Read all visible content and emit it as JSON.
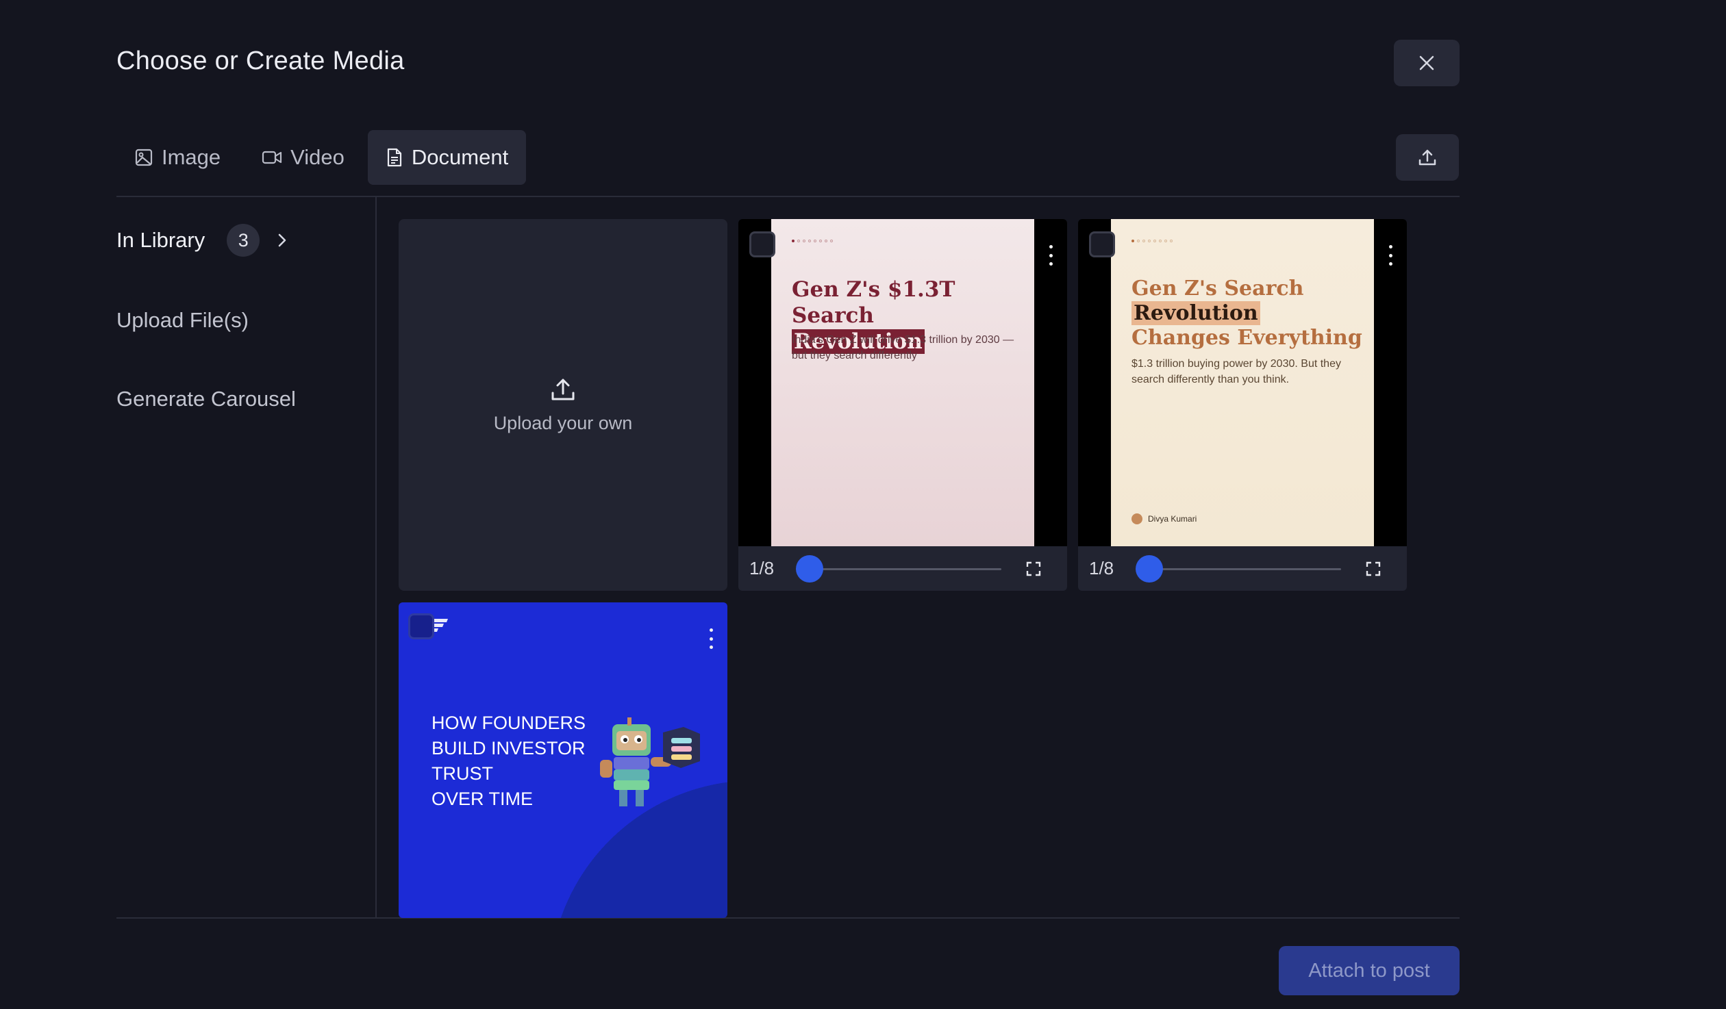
{
  "modal": {
    "title": "Choose or Create Media",
    "close_icon": "close-icon",
    "upload_icon": "upload-icon"
  },
  "tabs": [
    {
      "label": "Image",
      "icon": "image-icon",
      "active": false
    },
    {
      "label": "Video",
      "icon": "video-icon",
      "active": false
    },
    {
      "label": "Document",
      "icon": "document-icon",
      "active": true
    }
  ],
  "sidebar": {
    "in_library": {
      "label": "In Library",
      "count": "3",
      "icon": "chevron-right-icon"
    },
    "upload_files": {
      "label": "Upload File(s)"
    },
    "generate_carousel": {
      "label": "Generate Carousel"
    }
  },
  "grid": {
    "upload_card": {
      "label": "Upload your own",
      "icon": "upload-icon"
    },
    "documents": [
      {
        "title_line1": "Gen Z's $1.3T Search",
        "title_highlight": "Revolution",
        "subtitle": "India's Gen Z will drive $1.3 trillion by 2030 —but they search differently",
        "page_indicator": "1/8",
        "progress": 0.125
      },
      {
        "title_line1": "Gen Z's Search",
        "title_highlight": "Revolution",
        "title_rest": "Changes Everything",
        "subtitle": "$1.3 trillion buying power by 2030. But they search differently than you think.",
        "author": "Divya Kumari",
        "page_indicator": "1/8",
        "progress": 0.125
      }
    ],
    "promo_card": {
      "lines": [
        "HOW FOUNDERS",
        "BUILD INVESTOR",
        "TRUST",
        "OVER TIME"
      ]
    }
  },
  "footer": {
    "attach_label": "Attach to post"
  },
  "colors": {
    "background": "#14151f",
    "accent": "#2f5de9",
    "attach_button": "#2a3a8f"
  }
}
